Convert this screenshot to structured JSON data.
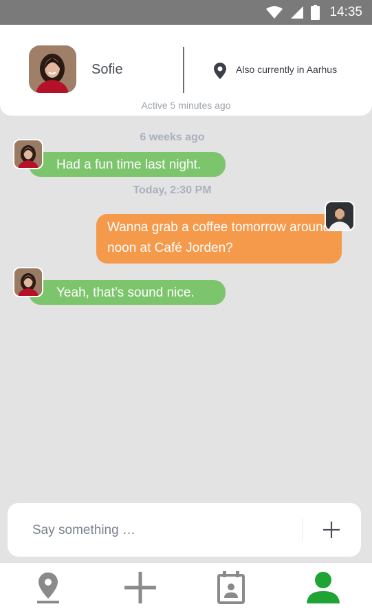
{
  "status_bar": {
    "time": "14:35"
  },
  "header": {
    "contact_name": "Sofie",
    "location_text": "Also currently in Aarhus",
    "active_text": "Active 5 minutes ago"
  },
  "messages": [
    {
      "timestamp": "6 weeks ago",
      "text": "Had a fun time last night.",
      "sender": "Sofie"
    },
    {
      "timestamp": "Today, 2:30 PM",
      "text": "Wanna grab a coffee tomorrow around noon at Café Jorden?",
      "sender": "me"
    },
    {
      "text": "Yeah, that’s sound nice.",
      "sender": "Sofie"
    }
  ],
  "composer": {
    "placeholder": "Say something …"
  },
  "nav": {
    "items": [
      {
        "icon": "location-pin-icon"
      },
      {
        "icon": "plus-icon"
      },
      {
        "icon": "calendar-contact-icon"
      },
      {
        "icon": "user-profile-icon",
        "active": true
      }
    ]
  },
  "colors": {
    "incoming_bubble": "#7dc56c",
    "outgoing_bubble": "#f5994b",
    "active_nav": "#20a335",
    "inactive_nav": "#8a8a8a"
  }
}
